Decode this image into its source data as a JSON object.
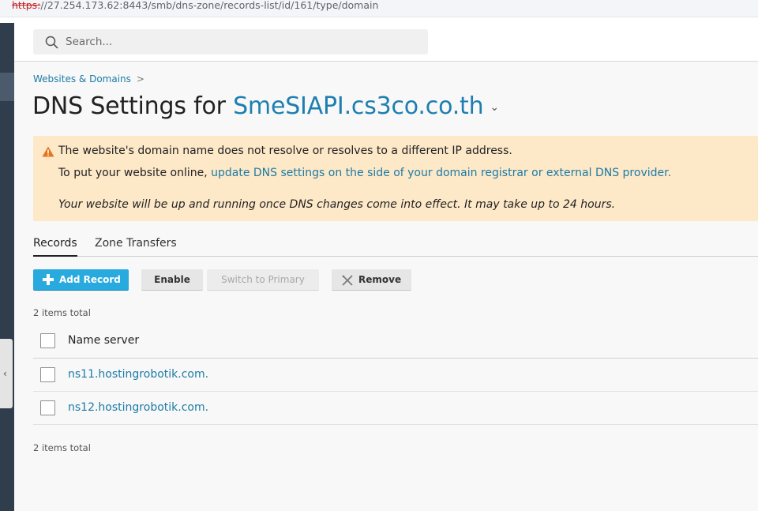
{
  "browser": {
    "url_protocol": "https:",
    "url_rest": "//27.254.173.62:8443/smb/dns-zone/records-list/id/161/type/domain"
  },
  "search": {
    "placeholder": "Search..."
  },
  "breadcrumb": {
    "item": "Websites & Domains",
    "separator": ">"
  },
  "title": {
    "prefix": "DNS Settings for ",
    "domain": "SmeSIAPI.cs3co.co.th",
    "caret": "⌄"
  },
  "alert": {
    "line1": "The website's domain name does not resolve or resolves to a different IP address.",
    "line2_text": "To put your website online, ",
    "line2_link": "update DNS settings on the side of your domain registrar or external DNS provider.",
    "line3": "Your website will be up and running once DNS changes come into effect. It may take up to 24 hours."
  },
  "tabs": [
    {
      "label": "Records"
    },
    {
      "label": "Zone Transfers"
    }
  ],
  "toolbar": {
    "add_label": "Add Record",
    "enable_label": "Enable",
    "switch_label": "Switch to Primary",
    "remove_label": "Remove"
  },
  "list": {
    "count_top": "2 items total",
    "count_bottom": "2 items total",
    "column_header": "Name server",
    "rows": [
      {
        "value": "ns11.hostingrobotik.com."
      },
      {
        "value": "ns12.hostingrobotik.com."
      }
    ]
  },
  "sidebar_toggle": {
    "icon": "‹"
  },
  "colors": {
    "accent": "#28aade",
    "link": "#1b7ba6",
    "alert_bg": "#fde8c8",
    "sidebar_bg": "#2f3d4c"
  }
}
